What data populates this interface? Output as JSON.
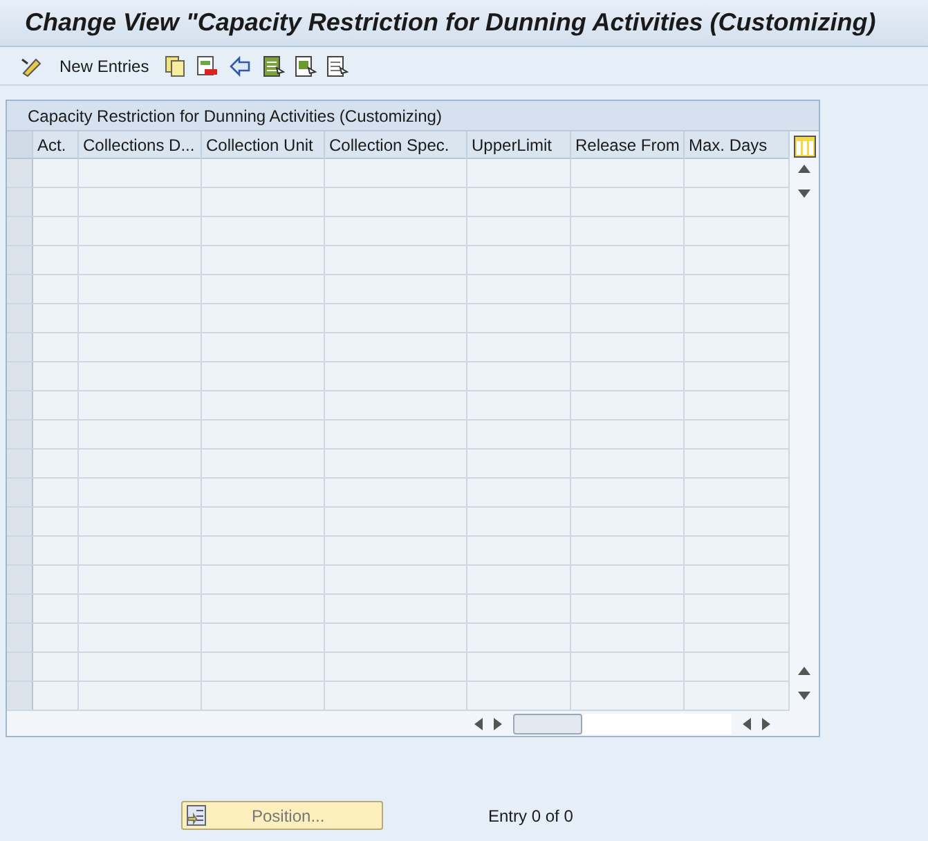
{
  "window": {
    "title": "Change View \"Capacity Restriction for Dunning Activities (Customizing)"
  },
  "toolbar": {
    "items": [
      {
        "kind": "change"
      },
      {
        "kind": "text",
        "label": "New Entries"
      },
      {
        "kind": "copy"
      },
      {
        "kind": "delete"
      },
      {
        "kind": "undo"
      },
      {
        "kind": "select-all"
      },
      {
        "kind": "select-block"
      },
      {
        "kind": "deselect"
      }
    ]
  },
  "table": {
    "title": "Capacity Restriction for Dunning Activities (Customizing)",
    "columns": [
      "Act.",
      "Collections D...",
      "Collection Unit",
      "Collection Spec.",
      "UpperLimit",
      "Release From",
      "Max. Days"
    ]
  },
  "footer": {
    "position_button": "Position...",
    "entry_text": "Entry 0 of 0"
  }
}
